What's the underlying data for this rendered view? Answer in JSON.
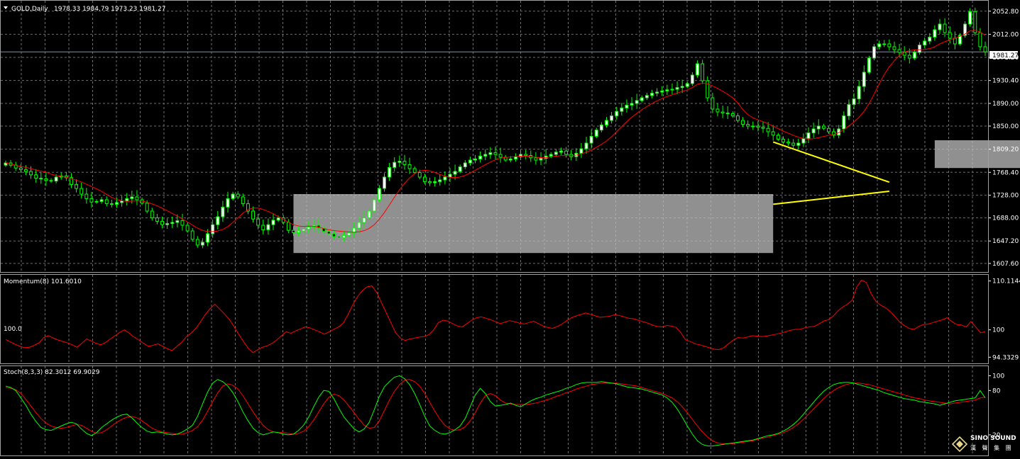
{
  "window": {
    "symbol_label": "GOLD,Daily",
    "ohlc_label": "1978.33 1984.79 1973.23 1981.27",
    "current_price_label": "1981.27"
  },
  "indicators": {
    "momentum_label": "Momentum(8) 101.6010",
    "momentum_ref_label": "100.0",
    "stoch_label": "Stoch(8,3,3) 82.3012 69.9029"
  },
  "branding": {
    "name": "SINO SOUND",
    "sub": "漢 聲 集 團"
  },
  "colors": {
    "background": "#000000",
    "grid": "#6e6e6e",
    "bull_candle": "#00ff00",
    "bull_body": "#ffffff",
    "bear_candle": "#00ff00",
    "bear_body": "#000000",
    "moving_average": "#ff0000",
    "momentum": "#ff0000",
    "stoch_main": "#00ff00",
    "stoch_signal": "#ff0000",
    "trendlines": "#ffff00",
    "range_boxes": "#c0c0c0",
    "axis_text": "#ffffff"
  },
  "chart_data": [
    {
      "type": "candlestick",
      "title": "GOLD,Daily",
      "y_ticks": [
        "2052.80",
        "2012.00",
        "1971.20",
        "1930.40",
        "1890.00",
        "1850.00",
        "1809.20",
        "1768.40",
        "1728.00",
        "1688.00",
        "1647.20",
        "1607.60"
      ],
      "ylim": [
        1595,
        2065
      ],
      "close": [
        1785,
        1781,
        1776,
        1773,
        1770,
        1764,
        1758,
        1757,
        1754,
        1753,
        1760,
        1762,
        1759,
        1747,
        1740,
        1730,
        1722,
        1716,
        1717,
        1720,
        1713,
        1712,
        1715,
        1718,
        1722,
        1725,
        1720,
        1714,
        1700,
        1688,
        1682,
        1676,
        1678,
        1680,
        1683,
        1675,
        1665,
        1650,
        1640,
        1645,
        1660,
        1676,
        1690,
        1707,
        1722,
        1730,
        1725,
        1713,
        1700,
        1686,
        1675,
        1667,
        1676,
        1684,
        1688,
        1680,
        1666,
        1662,
        1665,
        1668,
        1672,
        1675,
        1670,
        1664,
        1660,
        1655,
        1653,
        1657,
        1662,
        1670,
        1680,
        1688,
        1700,
        1720,
        1740,
        1760,
        1777,
        1786,
        1788,
        1782,
        1775,
        1768,
        1760,
        1752,
        1750,
        1752,
        1755,
        1760,
        1765,
        1770,
        1778,
        1785,
        1790,
        1792,
        1797,
        1800,
        1803,
        1800,
        1795,
        1790,
        1792,
        1796,
        1800,
        1798,
        1794,
        1790,
        1793,
        1797,
        1800,
        1804,
        1806,
        1800,
        1796,
        1802,
        1810,
        1820,
        1832,
        1843,
        1852,
        1860,
        1868,
        1876,
        1882,
        1887,
        1890,
        1895,
        1900,
        1904,
        1908,
        1910,
        1912,
        1914,
        1915,
        1918,
        1920,
        1925,
        1940,
        1960,
        1930,
        1900,
        1880,
        1875,
        1873,
        1872,
        1868,
        1860,
        1853,
        1850,
        1850,
        1848,
        1846,
        1840,
        1834,
        1827,
        1822,
        1820,
        1816,
        1820,
        1828,
        1838,
        1845,
        1850,
        1846,
        1840,
        1834,
        1845,
        1868,
        1888,
        1898,
        1920,
        1945,
        1970,
        1990,
        1995,
        1995,
        1990,
        1985,
        1980,
        1975,
        1970,
        1980,
        1993,
        2000,
        2007,
        2020,
        2030,
        2015,
        2005,
        1995,
        2010,
        2030,
        2052,
        2015,
        1990,
        1981
      ],
      "moving_average_color": "red"
    },
    {
      "type": "line",
      "title": "Momentum(8) 101.6010",
      "y_ticks": [
        "110.1144",
        "100",
        "94.3329"
      ],
      "ylim": [
        93.5,
        110.8
      ],
      "reference_level": 100,
      "values": [
        98.0,
        97.5,
        97.0,
        96.6,
        96.3,
        96.4,
        96.8,
        97.3,
        98.4,
        98.8,
        98.3,
        97.9,
        97.6,
        97.3,
        96.9,
        96.4,
        97.2,
        98.1,
        97.7,
        97.2,
        96.9,
        97.4,
        98.1,
        98.8,
        99.5,
        100.0,
        99.3,
        98.5,
        97.9,
        97.2,
        96.6,
        96.8,
        97.1,
        96.6,
        96.1,
        95.7,
        96.6,
        97.4,
        98.6,
        99.3,
        100.3,
        101.7,
        103.2,
        104.4,
        105.3,
        104.3,
        103.3,
        102.2,
        100.7,
        99.1,
        97.6,
        96.2,
        95.3,
        95.9,
        96.4,
        96.7,
        97.2,
        97.9,
        98.8,
        99.6,
        99.3,
        99.8,
        100.2,
        100.6,
        100.4,
        100.0,
        99.6,
        99.1,
        99.6,
        100.1,
        100.6,
        101.4,
        103.2,
        105.2,
        106.9,
        108.1,
        108.9,
        109.1,
        107.8,
        105.7,
        103.6,
        101.5,
        99.4,
        98.3,
        97.8,
        98.1,
        98.3,
        98.5,
        98.6,
        99.0,
        100.0,
        101.5,
        102.0,
        101.8,
        101.3,
        100.8,
        100.6,
        101.3,
        102.0,
        102.5,
        102.7,
        102.4,
        102.1,
        101.7,
        101.3,
        101.6,
        101.9,
        101.7,
        101.4,
        101.2,
        101.5,
        101.8,
        101.3,
        100.8,
        100.5,
        100.3,
        100.7,
        101.2,
        101.9,
        102.5,
        102.9,
        103.2,
        103.5,
        103.2,
        102.9,
        102.6,
        102.7,
        102.8,
        103.1,
        103.0,
        102.7,
        102.4,
        102.3,
        102.0,
        101.7,
        101.4,
        101.0,
        100.7,
        100.6,
        100.9,
        100.8,
        100.5,
        99.4,
        97.9,
        97.6,
        97.1,
        96.9,
        96.6,
        96.3,
        96.0,
        95.9,
        96.3,
        97.1,
        97.9,
        98.4,
        98.3,
        98.5,
        98.8,
        98.7,
        98.6,
        98.7,
        98.9,
        99.1,
        99.3,
        99.6,
        99.9,
        100.1,
        100.1,
        100.4,
        100.6,
        100.7,
        101.2,
        101.8,
        102.1,
        102.8,
        103.9,
        104.7,
        105.3,
        106.1,
        108.9,
        110.3,
        109.8,
        107.5,
        105.9,
        105.1,
        104.6,
        103.8,
        102.8,
        101.6,
        100.9,
        100.3,
        100.1,
        100.7,
        101.1,
        101.2,
        101.5,
        101.8,
        102.1,
        102.5,
        101.7,
        101.1,
        101.0,
        100.6,
        101.7,
        100.6,
        99.4,
        99.6
      ]
    },
    {
      "type": "line",
      "title": "Stoch(8,3,3) 82.3012 69.9029",
      "y_ticks": [
        "100",
        "80",
        "20"
      ],
      "ylim": [
        -5,
        110
      ],
      "series": [
        {
          "name": "main",
          "color": "green",
          "values": [
            86,
            84,
            80,
            70,
            60,
            48,
            38,
            30,
            27,
            26,
            29,
            32,
            35,
            37,
            35,
            28,
            22,
            19,
            23,
            30,
            35,
            40,
            44,
            47,
            48,
            43,
            36,
            30,
            25,
            23,
            24,
            23,
            21,
            20,
            21,
            24,
            28,
            33,
            45,
            62,
            78,
            90,
            95,
            92,
            86,
            77,
            65,
            51,
            39,
            29,
            23,
            20,
            22,
            24,
            23,
            21,
            20,
            21,
            26,
            33,
            44,
            58,
            71,
            80,
            79,
            69,
            56,
            44,
            36,
            28,
            24,
            28,
            37,
            54,
            72,
            85,
            92,
            98,
            100,
            96,
            88,
            76,
            61,
            45,
            32,
            26,
            22,
            21,
            23,
            27,
            32,
            42,
            58,
            74,
            83,
            76,
            65,
            59,
            60,
            61,
            63,
            60,
            58,
            62,
            66,
            69,
            71,
            74,
            76,
            78,
            80,
            83,
            85,
            88,
            90,
            91,
            91,
            91,
            92,
            91,
            90,
            89,
            87,
            85,
            84,
            83,
            82,
            80,
            78,
            76,
            74,
            70,
            64,
            55,
            44,
            32,
            21,
            12,
            7,
            5,
            5,
            6,
            7,
            8,
            9,
            10,
            11,
            12,
            13,
            15,
            17,
            19,
            20,
            22,
            25,
            29,
            34,
            40,
            48,
            56,
            64,
            72,
            79,
            84,
            88,
            90,
            91,
            91,
            90,
            88,
            86,
            84,
            82,
            80,
            77,
            75,
            73,
            71,
            69,
            68,
            67,
            65,
            64,
            63,
            62,
            60,
            62,
            64,
            66,
            67,
            68,
            69,
            70,
            80,
            70
          ]
        },
        {
          "name": "signal",
          "color": "red",
          "values": [
            84,
            83,
            81,
            76,
            68,
            59,
            50,
            42,
            36,
            32,
            30,
            29,
            30,
            32,
            34,
            33,
            29,
            25,
            22,
            23,
            27,
            32,
            37,
            41,
            44,
            45,
            43,
            39,
            34,
            29,
            26,
            24,
            23,
            22,
            21,
            21,
            23,
            26,
            31,
            40,
            52,
            65,
            77,
            86,
            89,
            87,
            82,
            73,
            62,
            51,
            41,
            33,
            27,
            24,
            23,
            23,
            22,
            21,
            22,
            25,
            31,
            40,
            51,
            62,
            71,
            75,
            73,
            67,
            59,
            50,
            41,
            33,
            29,
            30,
            39,
            53,
            67,
            79,
            88,
            94,
            95,
            92,
            86,
            76,
            64,
            52,
            41,
            33,
            28,
            26,
            27,
            31,
            39,
            50,
            63,
            73,
            76,
            73,
            67,
            63,
            62,
            61,
            61,
            61,
            62,
            63,
            65,
            67,
            69,
            72,
            74,
            77,
            79,
            82,
            84,
            86,
            88,
            89,
            90,
            90,
            90,
            90,
            89,
            88,
            87,
            86,
            84,
            82,
            80,
            78,
            76,
            73,
            70,
            65,
            58,
            50,
            41,
            32,
            24,
            17,
            12,
            9,
            8,
            8,
            8,
            9,
            10,
            11,
            12,
            14,
            16,
            17,
            19,
            21,
            23,
            26,
            30,
            35,
            41,
            48,
            55,
            62,
            69,
            75,
            80,
            84,
            87,
            89,
            90,
            90,
            89,
            88,
            86,
            84,
            82,
            80,
            78,
            76,
            74,
            72,
            70,
            69,
            67,
            66,
            65,
            64,
            63,
            62,
            63,
            64,
            65,
            66,
            67,
            70,
            71
          ]
        }
      ]
    }
  ]
}
